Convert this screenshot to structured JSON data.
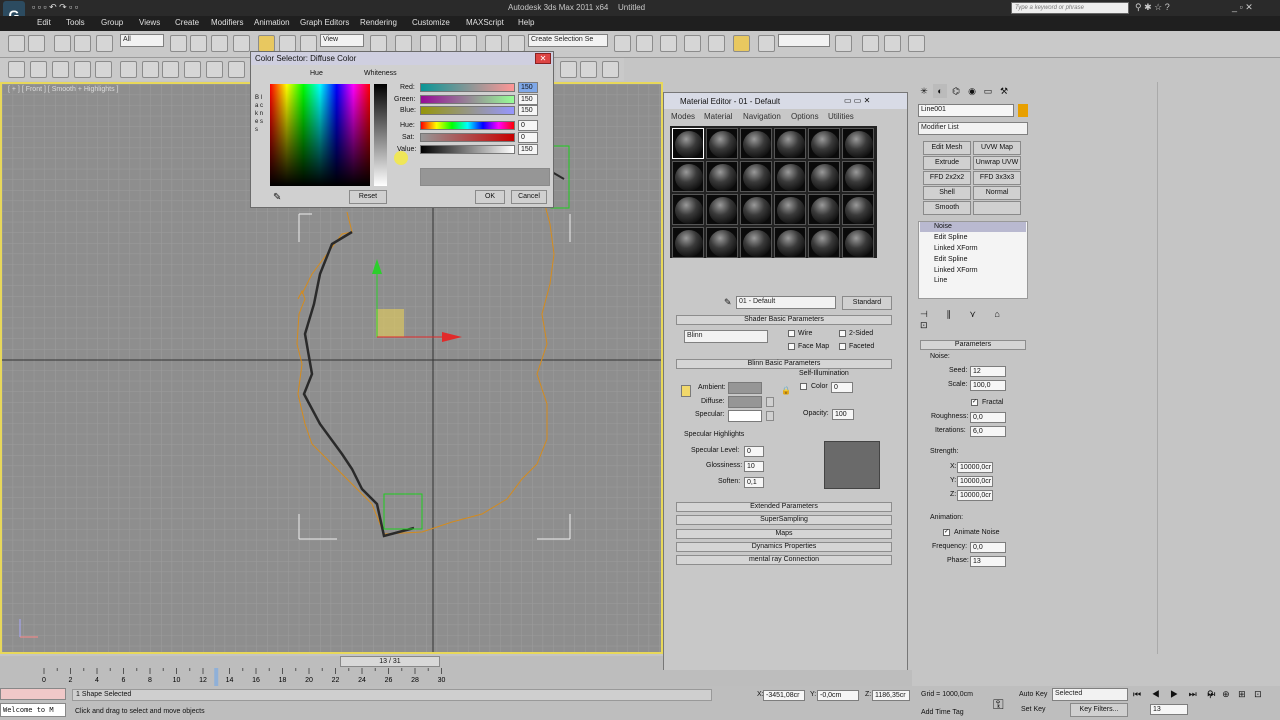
{
  "window": {
    "title": "Autodesk 3ds Max 2011 x64",
    "doc": "Untitled",
    "search_placeholder": "Type a keyword or phrase"
  },
  "menu": [
    "Edit",
    "Tools",
    "Group",
    "Views",
    "Create",
    "Modifiers",
    "Animation",
    "Graph Editors",
    "Rendering",
    "Customize",
    "MAXScript",
    "Help"
  ],
  "toolbar": {
    "filter": "All",
    "refcoord": "View",
    "selection_set": "Create Selection Se"
  },
  "viewport": {
    "label": "[ + ] [ Front ] [ Smooth + Highlights ]"
  },
  "color_selector": {
    "title": "Color Selector: Diffuse Color",
    "hue_label": "Hue",
    "whiteness_label": "Whiteness",
    "blackness_label": "B l a c k n e s s",
    "channels": [
      {
        "name": "Red:",
        "value": "150"
      },
      {
        "name": "Green:",
        "value": "150"
      },
      {
        "name": "Blue:",
        "value": "150"
      }
    ],
    "hsv": [
      {
        "name": "Hue:",
        "value": "0"
      },
      {
        "name": "Sat:",
        "value": "0"
      },
      {
        "name": "Value:",
        "value": "150"
      }
    ],
    "reset": "Reset",
    "ok": "OK",
    "cancel": "Cancel"
  },
  "material_editor": {
    "title": "Material Editor - 01 - Default",
    "menus": [
      "Modes",
      "Material",
      "Navigation",
      "Options",
      "Utilities"
    ],
    "material_name": "01 - Default",
    "material_type": "Standard",
    "shader_rollout": "Shader Basic Parameters",
    "shader": "Blinn",
    "shader_options": [
      "Wire",
      "2-Sided",
      "Face Map",
      "Faceted"
    ],
    "blinn_rollout": "Blinn Basic Parameters",
    "self_illum": "Self-Illumination",
    "color_label": "Color",
    "color_value": "0",
    "ambient": "Ambient:",
    "diffuse": "Diffuse:",
    "specular": "Specular:",
    "opacity_label": "Opacity:",
    "opacity_value": "100",
    "spec_highlights": "Specular Highlights",
    "spec_level_label": "Specular Level:",
    "spec_level": "0",
    "gloss_label": "Glossiness:",
    "gloss": "10",
    "soften_label": "Soften:",
    "soften": "0,1",
    "rollouts": [
      "Extended Parameters",
      "SuperSampling",
      "Maps",
      "Dynamics Properties",
      "mental ray Connection"
    ]
  },
  "command_panel": {
    "object_name": "Line001",
    "modifier_list": "Modifier List",
    "buttons": [
      "Edit Mesh",
      "UVW Map",
      "Extrude",
      "Unwrap UVW",
      "FFD 2x2x2",
      "FFD 3x3x3",
      "Shell",
      "Normal",
      "Smooth",
      ""
    ],
    "stack": [
      "Noise",
      "Edit Spline",
      "Linked XForm",
      "Edit Spline",
      "Linked XForm",
      "Line"
    ],
    "params_title": "Parameters",
    "noise_group": "Noise:",
    "seed_label": "Seed:",
    "seed": "12",
    "scale_label": "Scale:",
    "scale": "100,0",
    "fractal": "Fractal",
    "roughness_label": "Roughness:",
    "roughness": "0,0",
    "iterations_label": "Iterations:",
    "iterations": "6,0",
    "strength_group": "Strength:",
    "x_label": "X:",
    "x": "10000,0cr",
    "y_label": "Y:",
    "y": "10000,0cr",
    "z_label": "Z:",
    "z": "10000,0cr",
    "anim_group": "Animation:",
    "animate_noise": "Animate Noise",
    "freq_label": "Frequency:",
    "freq": "0,0",
    "phase_label": "Phase:",
    "phase": "13"
  },
  "timeline": {
    "frame": "13 / 31",
    "ticks": [
      "0",
      "2",
      "4",
      "6",
      "8",
      "10",
      "12",
      "14",
      "16",
      "18",
      "20",
      "22",
      "24",
      "26",
      "28",
      "30"
    ]
  },
  "status": {
    "maxscript": "Welcome to M",
    "selected": "1 Shape Selected",
    "prompt": "Click and drag to select and move objects",
    "x_label": "X:",
    "x": "-3451,08cr",
    "y_label": "Y:",
    "y": "-0,0cm",
    "z_label": "Z:",
    "z": "1186,35cr",
    "grid": "Grid = 1000,0cm",
    "add_time_tag": "Add Time Tag",
    "autokey": "Auto Key",
    "setkey": "Set Key",
    "selected_dd": "Selected",
    "key_filters": "Key Filters...",
    "frame": "13"
  }
}
